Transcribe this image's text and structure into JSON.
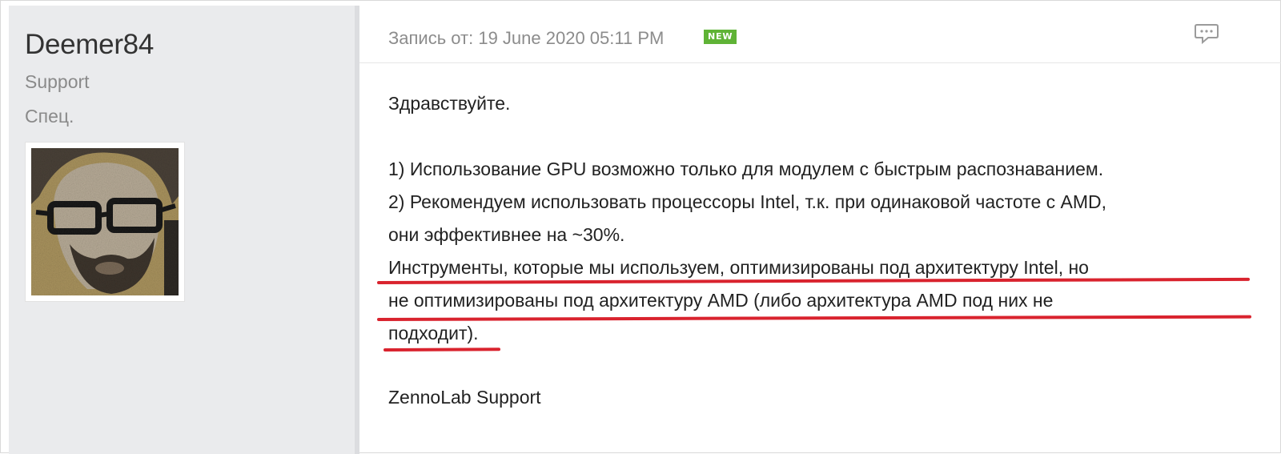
{
  "user": {
    "name": "Deemer84",
    "role": "Support",
    "rank": "Спец."
  },
  "post": {
    "date": "Запись от: 19 June 2020 05:11 PM",
    "badge": "NEW",
    "lines": [
      "Здравствуйте.",
      "1) Использование GPU возможно только для модулем с быстрым распознаванием.",
      "2) Рекомендуем использовать процессоры Intel, т.к. при одинаковой частоте с AMD,",
      "они эффективнее на ~30%.",
      "Инструменты, которые мы используем, оптимизированы под архитектуру Intel, но",
      "не оптимизированы под архитектуру AMD (либо архитектура AMD под них не",
      "подходит).",
      "ZennoLab Support"
    ]
  },
  "icons": {
    "comment": "comment-bubble-icon",
    "avatar": "user-avatar-image"
  },
  "colors": {
    "badge": "#5fb336",
    "annotation": "#d9232e",
    "sidebar": "#eaebed"
  }
}
